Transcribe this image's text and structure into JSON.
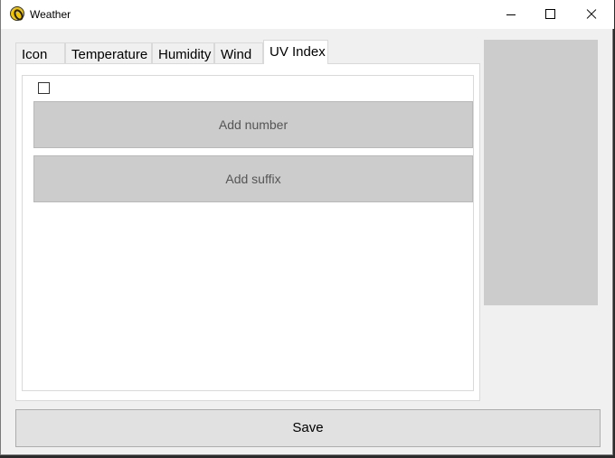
{
  "window": {
    "title": "Weather",
    "controls": [
      "minimize-icon",
      "maximize-icon",
      "close-icon"
    ]
  },
  "tabs": [
    {
      "label": "Icon",
      "active": false
    },
    {
      "label": "Temperature",
      "active": false
    },
    {
      "label": "Humidity",
      "active": false
    },
    {
      "label": "Wind",
      "active": false
    },
    {
      "label": "UV Index",
      "active": true
    }
  ],
  "uv_panel": {
    "enabled_checked": false,
    "add_number_label": "Add number",
    "add_suffix_label": "Add suffix"
  },
  "footer": {
    "save_label": "Save"
  },
  "colors": {
    "panel_bg": "#ffffff",
    "window_bg": "#f0f0f0",
    "button_bg": "#cccccc",
    "preview_bg": "#cccccc"
  }
}
